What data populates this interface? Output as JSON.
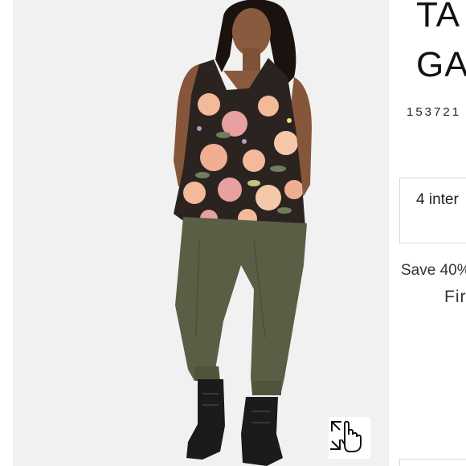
{
  "product": {
    "title_line1": "TA",
    "title_line2": "GA",
    "sku": "153721"
  },
  "payment": {
    "installments_text": "4 inter"
  },
  "promo": {
    "save_text": "Save 40%",
    "link_text": "Fir"
  },
  "gallery": {
    "zoom_icon": "pointer-hand-expand-icon"
  },
  "colors": {
    "background": "#f1f1f1",
    "pants": "#5a5e45",
    "boots": "#1b1b1b",
    "top_base": "#2b2320",
    "floral_peach": "#f2b99a",
    "floral_pink": "#e9a0a0",
    "leaf_green": "#6f7d5a"
  }
}
